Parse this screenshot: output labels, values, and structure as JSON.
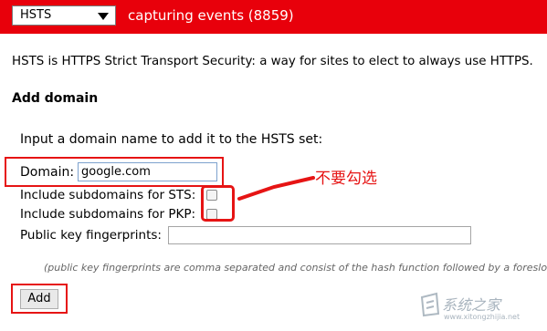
{
  "header": {
    "select_value": "HSTS",
    "status": "capturing events (8859)",
    "bar_color": "#e8000b"
  },
  "intro_text": "HSTS is HTTPS Strict Transport Security: a way for sites to elect to always use HTTPS.",
  "add_domain": {
    "heading": "Add domain",
    "description": "Input a domain name to add it to the HSTS set:",
    "domain_label": "Domain:",
    "domain_value": "google.com",
    "include_sts_label": "Include subdomains for STS:",
    "include_pkp_label": "Include subdomains for PKP:",
    "include_sts_checked": false,
    "include_pkp_checked": false,
    "fingerprints_label": "Public key fingerprints:",
    "fingerprints_value": "",
    "note": "(public key fingerprints are comma separated and consist of the hash function followed by a foreslo",
    "add_button": "Add"
  },
  "annotation": {
    "note": "不要勾选",
    "color": "#e61414"
  },
  "watermark": {
    "text": "系统之家",
    "url": "www.xitongzhijia.net"
  }
}
